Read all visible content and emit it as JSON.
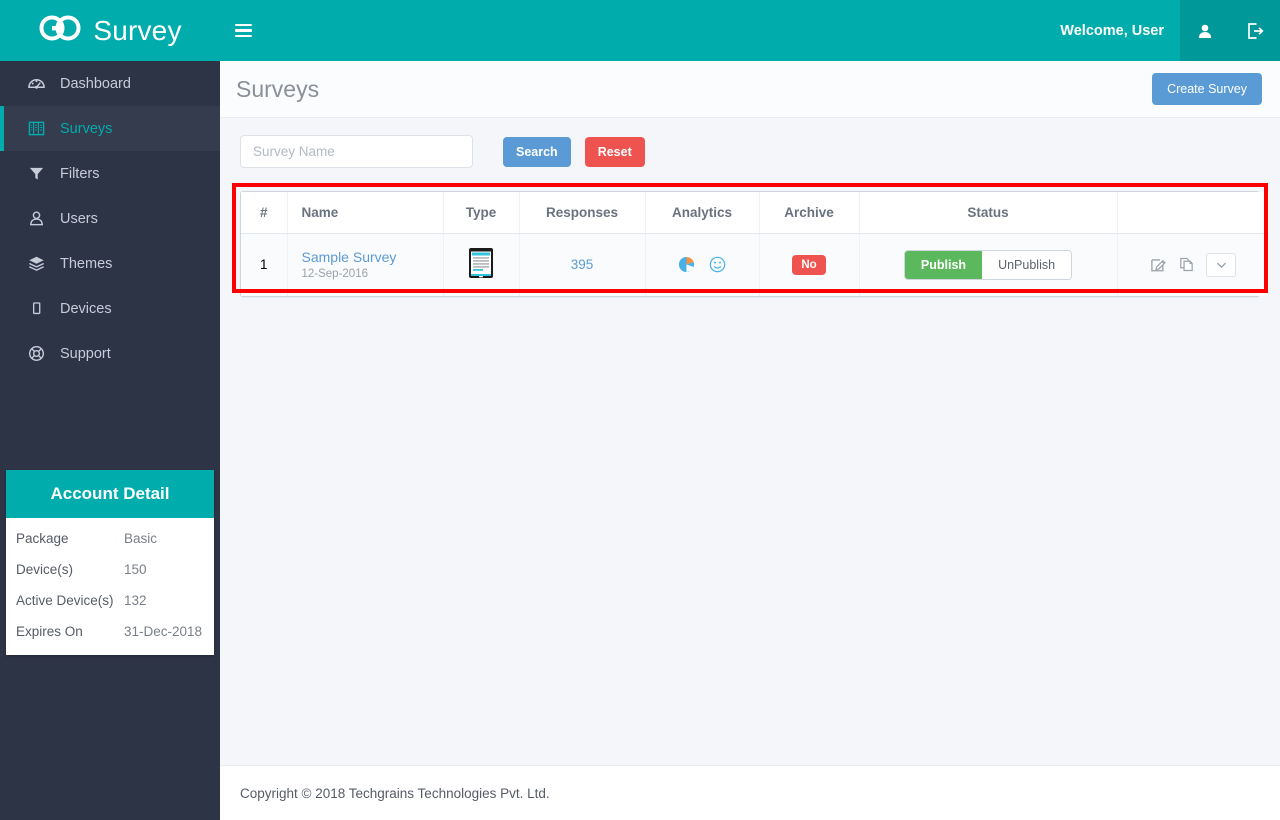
{
  "navbar": {
    "brand": "Survey",
    "brand_icon": "go-infinity-logo-icon",
    "hamburger_icon": "hamburger-menu-icon",
    "welcome": "Welcome, User",
    "user_icon": "user-icon",
    "logout_icon": "logout-icon"
  },
  "sidebar": {
    "items": [
      {
        "label": "Dashboard",
        "icon": "dashboard-gauge-icon",
        "active": false
      },
      {
        "label": "Surveys",
        "icon": "book-icon",
        "active": true
      },
      {
        "label": "Filters",
        "icon": "funnel-icon",
        "active": false
      },
      {
        "label": "Users",
        "icon": "user-outline-icon",
        "active": false
      },
      {
        "label": "Themes",
        "icon": "layers-icon",
        "active": false
      },
      {
        "label": "Devices",
        "icon": "tablet-icon",
        "active": false
      },
      {
        "label": "Support",
        "icon": "life-ring-icon",
        "active": false
      }
    ],
    "account": {
      "title": "Account Detail",
      "rows": [
        {
          "key": "Package",
          "value": "Basic"
        },
        {
          "key": "Device(s)",
          "value": "150"
        },
        {
          "key": "Active Device(s)",
          "value": "132"
        },
        {
          "key": "Expires On",
          "value": "31-Dec-2018"
        }
      ]
    }
  },
  "page": {
    "title": "Surveys",
    "create_button": "Create Survey"
  },
  "toolbar": {
    "search_placeholder": "Survey Name",
    "search_value": "",
    "search_button": "Search",
    "reset_button": "Reset"
  },
  "table": {
    "headers": [
      "#",
      "Name",
      "Type",
      "Responses",
      "Analytics",
      "Archive",
      "Status",
      ""
    ],
    "rows": [
      {
        "index": "1",
        "name": "Sample Survey",
        "date": "12-Sep-2016",
        "type_icon": "tablet-document-icon",
        "responses": "395",
        "analytics_icons": [
          "pie-chart-icon",
          "smiley-face-icon"
        ],
        "archive": "No",
        "status_publish": "Publish",
        "status_unpublish": "UnPublish",
        "status_active": "Publish",
        "actions": [
          "edit-icon",
          "duplicate-icon",
          "chevron-down-icon"
        ]
      }
    ]
  },
  "footer": {
    "copyright": "Copyright © 2018 Techgrains Technologies Pvt. Ltd."
  },
  "colors": {
    "teal": "#00acac",
    "teal_dark": "#009899",
    "sidebar": "#2d3446",
    "sidebar_active": "#353c4e",
    "blue": "#5b9bd5",
    "red": "#ef5350",
    "green": "#5cb85c",
    "highlight": "#fc0000"
  }
}
